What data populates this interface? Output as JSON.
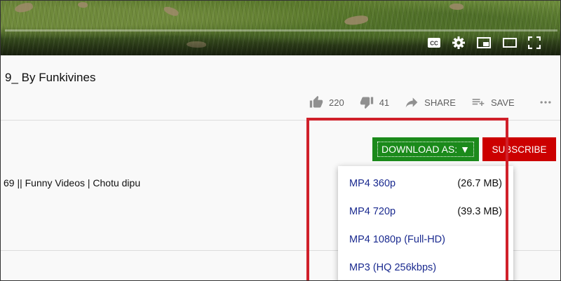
{
  "video": {
    "controls": [
      "captions-icon",
      "settings-icon",
      "miniplayer-icon",
      "theater-mode-icon",
      "fullscreen-icon"
    ],
    "captions_label": "CC"
  },
  "title": "9_ By Funkivines",
  "actions": {
    "like_count": "220",
    "dislike_count": "41",
    "share_label": "SHARE",
    "save_label": "SAVE"
  },
  "description_snippet": "69 || Funny Videos | Chotu dipu",
  "download": {
    "button_label": "DOWNLOAD AS:",
    "arrow": "▼",
    "options": [
      {
        "label": "MP4 360p",
        "size": "(26.7 MB)"
      },
      {
        "label": "MP4 720p",
        "size": "(39.3 MB)"
      },
      {
        "label": "MP4 1080p (Full-HD)",
        "size": ""
      },
      {
        "label": "MP3 (HQ 256kbps)",
        "size": ""
      }
    ]
  },
  "subscribe": {
    "label": "SUBSCRIBE"
  },
  "colors": {
    "download_bg": "#1b8a1b",
    "subscribe_bg": "#cc0000",
    "highlight": "#d0202a",
    "option_text": "#1a2a8f"
  }
}
